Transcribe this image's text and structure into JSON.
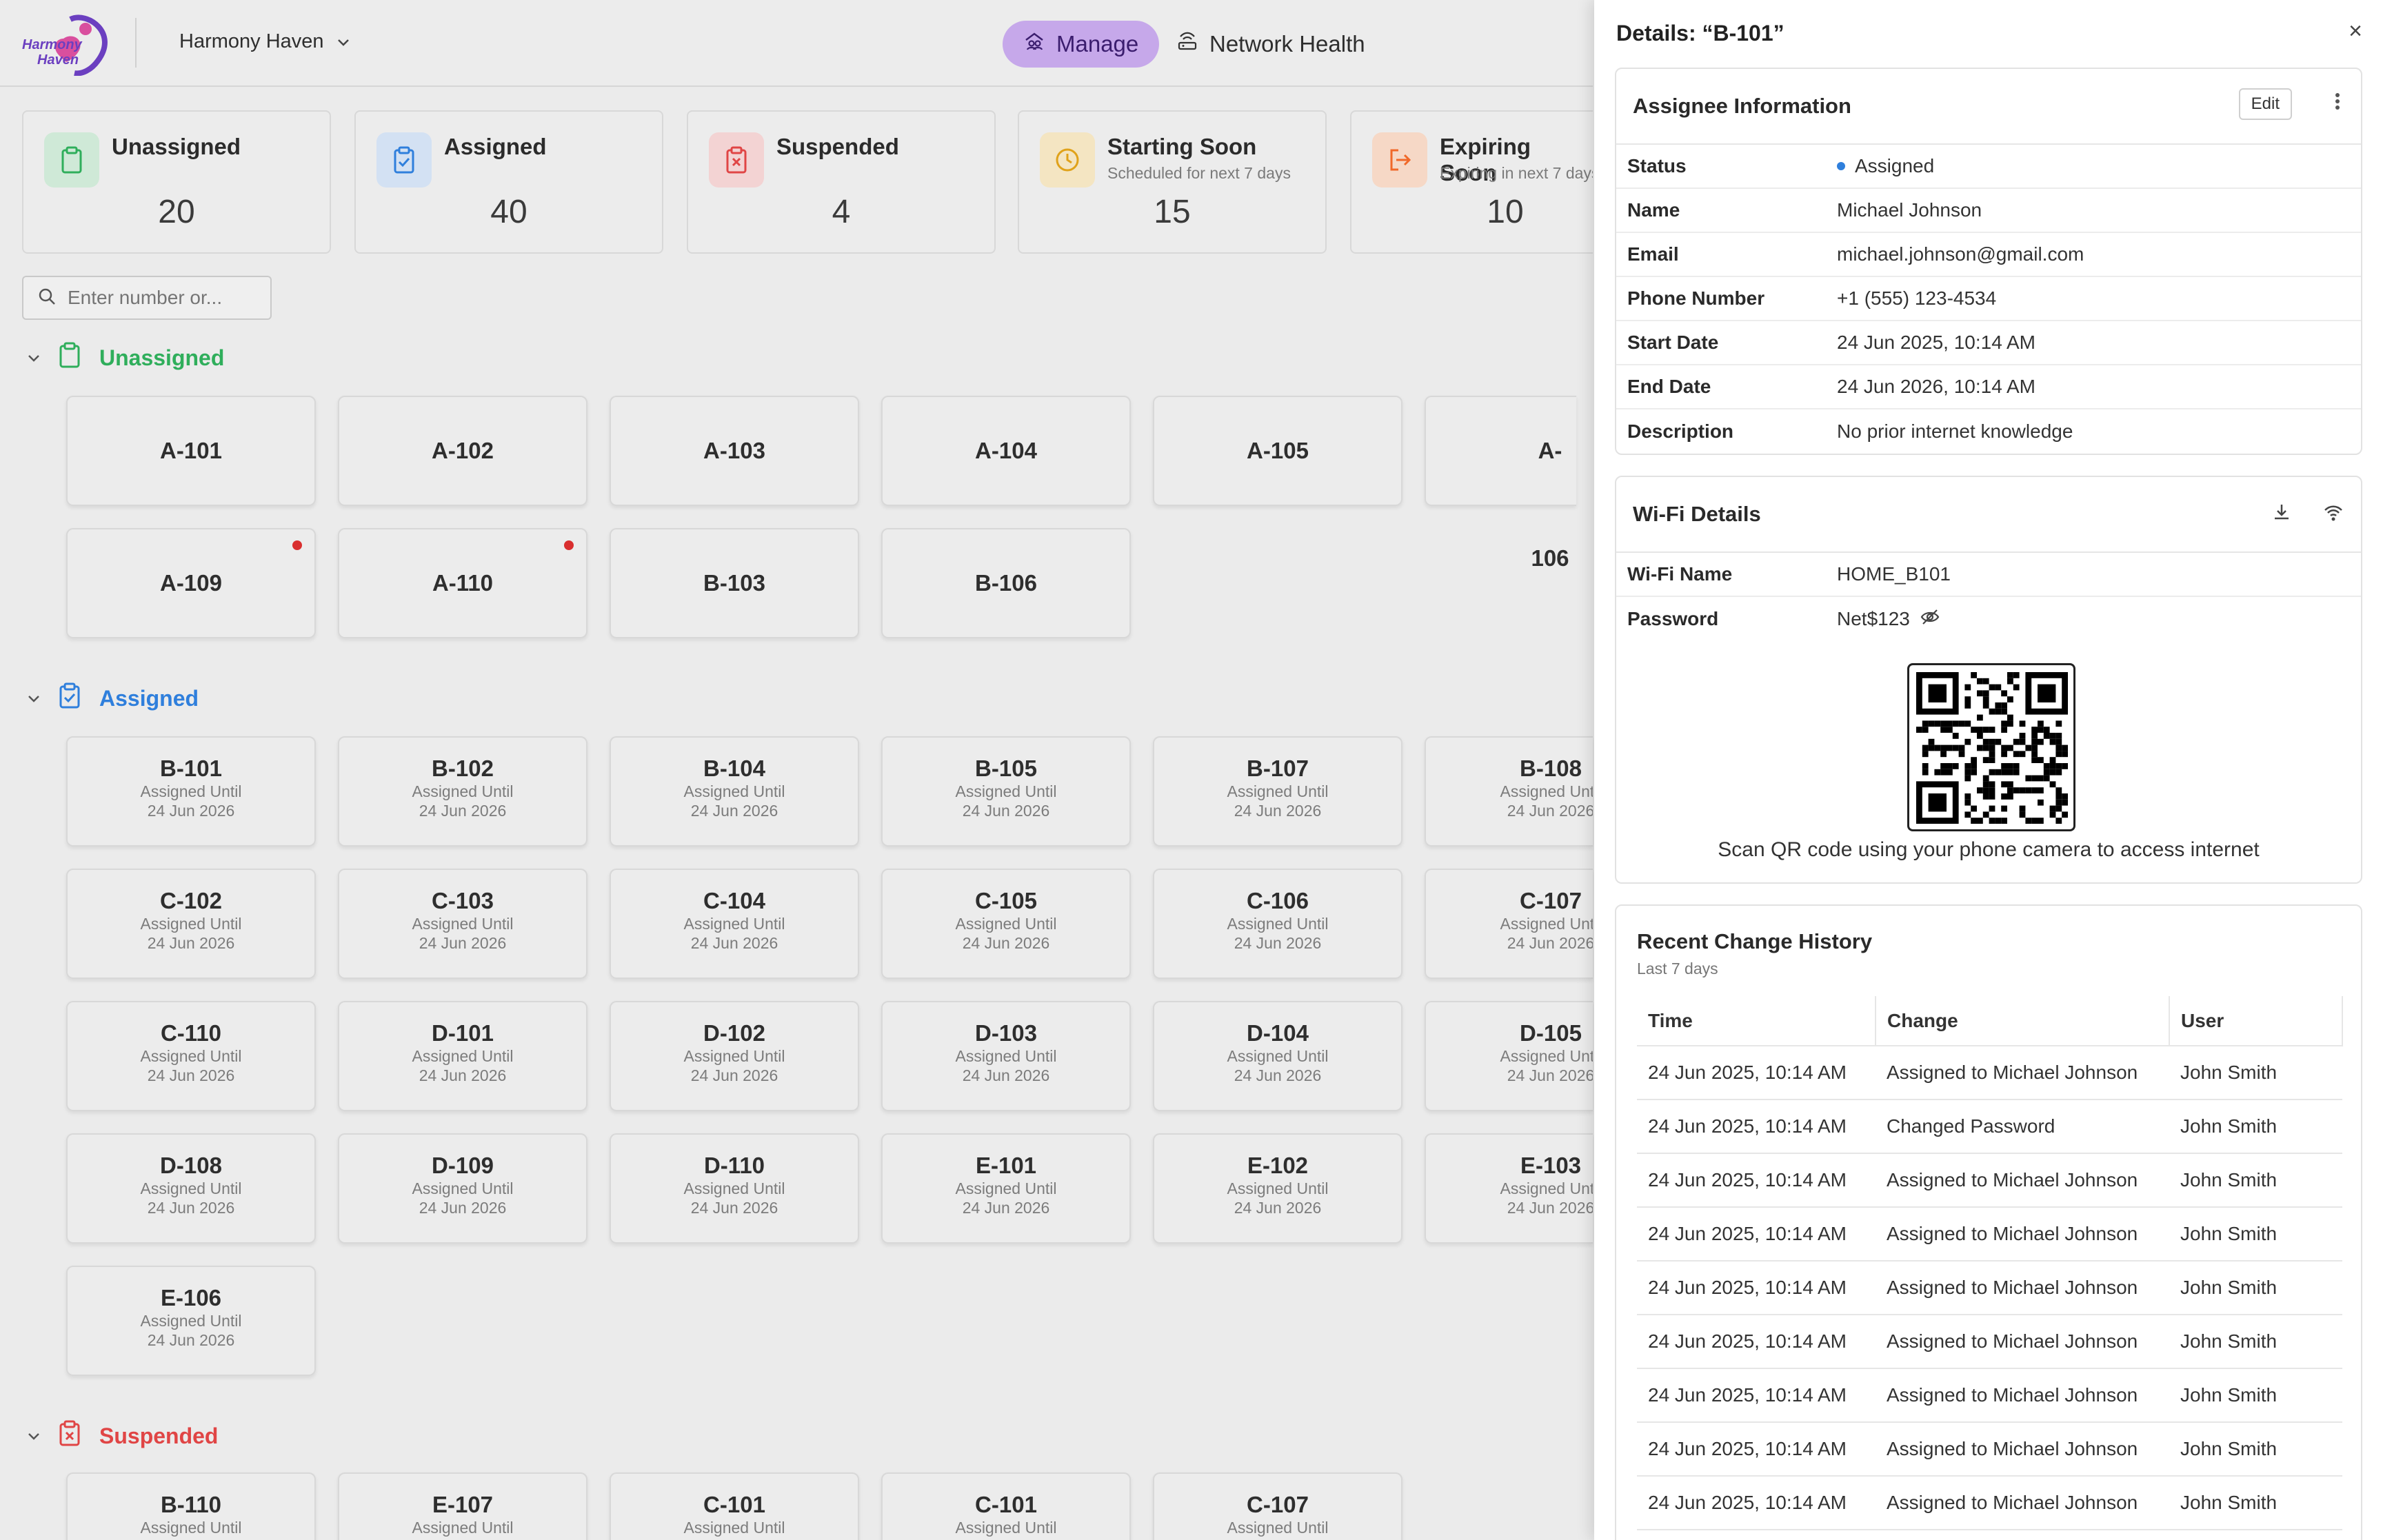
{
  "app": {
    "logo_text_top": "Harmony",
    "logo_text_bottom": "Haven",
    "org_name": "Harmony Haven"
  },
  "nav": {
    "manage": "Manage",
    "network_health": "Network Health"
  },
  "stats": [
    {
      "label": "Unassigned",
      "sub": "",
      "value": "20",
      "color": "#2fae5b"
    },
    {
      "label": "Assigned",
      "sub": "",
      "value": "40",
      "color": "#2f7fdc"
    },
    {
      "label": "Suspended",
      "sub": "",
      "value": "4",
      "color": "#e04545"
    },
    {
      "label": "Starting Soon",
      "sub": "Scheduled for next 7 days",
      "value": "15",
      "color": "#e0a21a"
    },
    {
      "label": "Expiring Soon",
      "sub": "Expiring in next 7 days",
      "value": "10",
      "color": "#f0692a"
    }
  ],
  "search": {
    "placeholder": "Enter number or..."
  },
  "sections": {
    "unassigned": "Unassigned",
    "assigned": "Assigned",
    "suspended": "Suspended"
  },
  "tile_sub_label": "Assigned Until",
  "unassigned_tiles": [
    "A-101",
    "A-102",
    "A-103",
    "A-104",
    "A-105",
    "A-106",
    "A-109",
    "A-110",
    "B-103",
    "B-106"
  ],
  "assigned_tiles": [
    {
      "id": "B-101",
      "date": "24 Jun 2026"
    },
    {
      "id": "B-102",
      "date": "24 Jun 2026"
    },
    {
      "id": "B-104",
      "date": "24 Jun 2026"
    },
    {
      "id": "B-105",
      "date": "24 Jun 2026"
    },
    {
      "id": "B-107",
      "date": "24 Jun 2026"
    },
    {
      "id": "B-108",
      "date": "24 Jun 2026"
    },
    {
      "id": "C-102",
      "date": "24 Jun 2026"
    },
    {
      "id": "C-103",
      "date": "24 Jun 2026"
    },
    {
      "id": "C-104",
      "date": "24 Jun 2026"
    },
    {
      "id": "C-105",
      "date": "24 Jun 2026"
    },
    {
      "id": "C-106",
      "date": "24 Jun 2026"
    },
    {
      "id": "C-107",
      "date": "24 Jun 2026"
    },
    {
      "id": "C-110",
      "date": "24 Jun 2026"
    },
    {
      "id": "D-101",
      "date": "24 Jun 2026"
    },
    {
      "id": "D-102",
      "date": "24 Jun 2026"
    },
    {
      "id": "D-103",
      "date": "24 Jun 2026"
    },
    {
      "id": "D-104",
      "date": "24 Jun 2026"
    },
    {
      "id": "D-105",
      "date": "24 Jun 2026"
    },
    {
      "id": "D-108",
      "date": "24 Jun 2026"
    },
    {
      "id": "D-109",
      "date": "24 Jun 2026"
    },
    {
      "id": "D-110",
      "date": "24 Jun 2026"
    },
    {
      "id": "E-101",
      "date": "24 Jun 2026"
    },
    {
      "id": "E-102",
      "date": "24 Jun 2026"
    },
    {
      "id": "E-103",
      "date": "24 Jun 2026"
    },
    {
      "id": "E-106",
      "date": "24 Jun 2026"
    }
  ],
  "suspended_tiles": [
    "B-110",
    "E-107",
    "C-101",
    "C-101",
    "C-107"
  ],
  "panel": {
    "title": "Details: “B-101”",
    "close": "×",
    "assignee": {
      "header": "Assignee Information",
      "edit": "Edit",
      "rows": [
        {
          "k": "Status",
          "v": "Assigned"
        },
        {
          "k": "Name",
          "v": "Michael Johnson"
        },
        {
          "k": "Email",
          "v": "michael.johnson@gmail.com"
        },
        {
          "k": "Phone Number",
          "v": "+1 (555) 123-4534"
        },
        {
          "k": "Start Date",
          "v": "24 Jun 2025, 10:14 AM"
        },
        {
          "k": "End Date",
          "v": "24 Jun 2026, 10:14 AM"
        },
        {
          "k": "Description",
          "v": "No prior internet knowledge"
        }
      ]
    },
    "wifi": {
      "header": "Wi-Fi Details",
      "name_label": "Wi-Fi Name",
      "name": "HOME_B101",
      "password_label": "Password",
      "password": "Net$123",
      "qr_caption": "Scan QR code using your phone camera to access internet"
    },
    "history": {
      "header": "Recent Change History",
      "sub": "Last 7 days",
      "columns": [
        "Time",
        "Change",
        "User"
      ],
      "rows": [
        [
          "24 Jun 2025, 10:14 AM",
          "Assigned to Michael Johnson",
          "John Smith"
        ],
        [
          "24 Jun 2025, 10:14 AM",
          "Changed Password",
          "John Smith"
        ],
        [
          "24 Jun 2025, 10:14 AM",
          "Assigned to Michael Johnson",
          "John Smith"
        ],
        [
          "24 Jun 2025, 10:14 AM",
          "Assigned to Michael Johnson",
          "John Smith"
        ],
        [
          "24 Jun 2025, 10:14 AM",
          "Assigned to Michael Johnson",
          "John Smith"
        ],
        [
          "24 Jun 2025, 10:14 AM",
          "Assigned to Michael Johnson",
          "John Smith"
        ],
        [
          "24 Jun 2025, 10:14 AM",
          "Assigned to Michael Johnson",
          "John Smith"
        ],
        [
          "24 Jun 2025, 10:14 AM",
          "Assigned to Michael Johnson",
          "John Smith"
        ],
        [
          "24 Jun 2025, 10:14 AM",
          "Assigned to Michael Johnson",
          "John Smith"
        ]
      ]
    }
  }
}
